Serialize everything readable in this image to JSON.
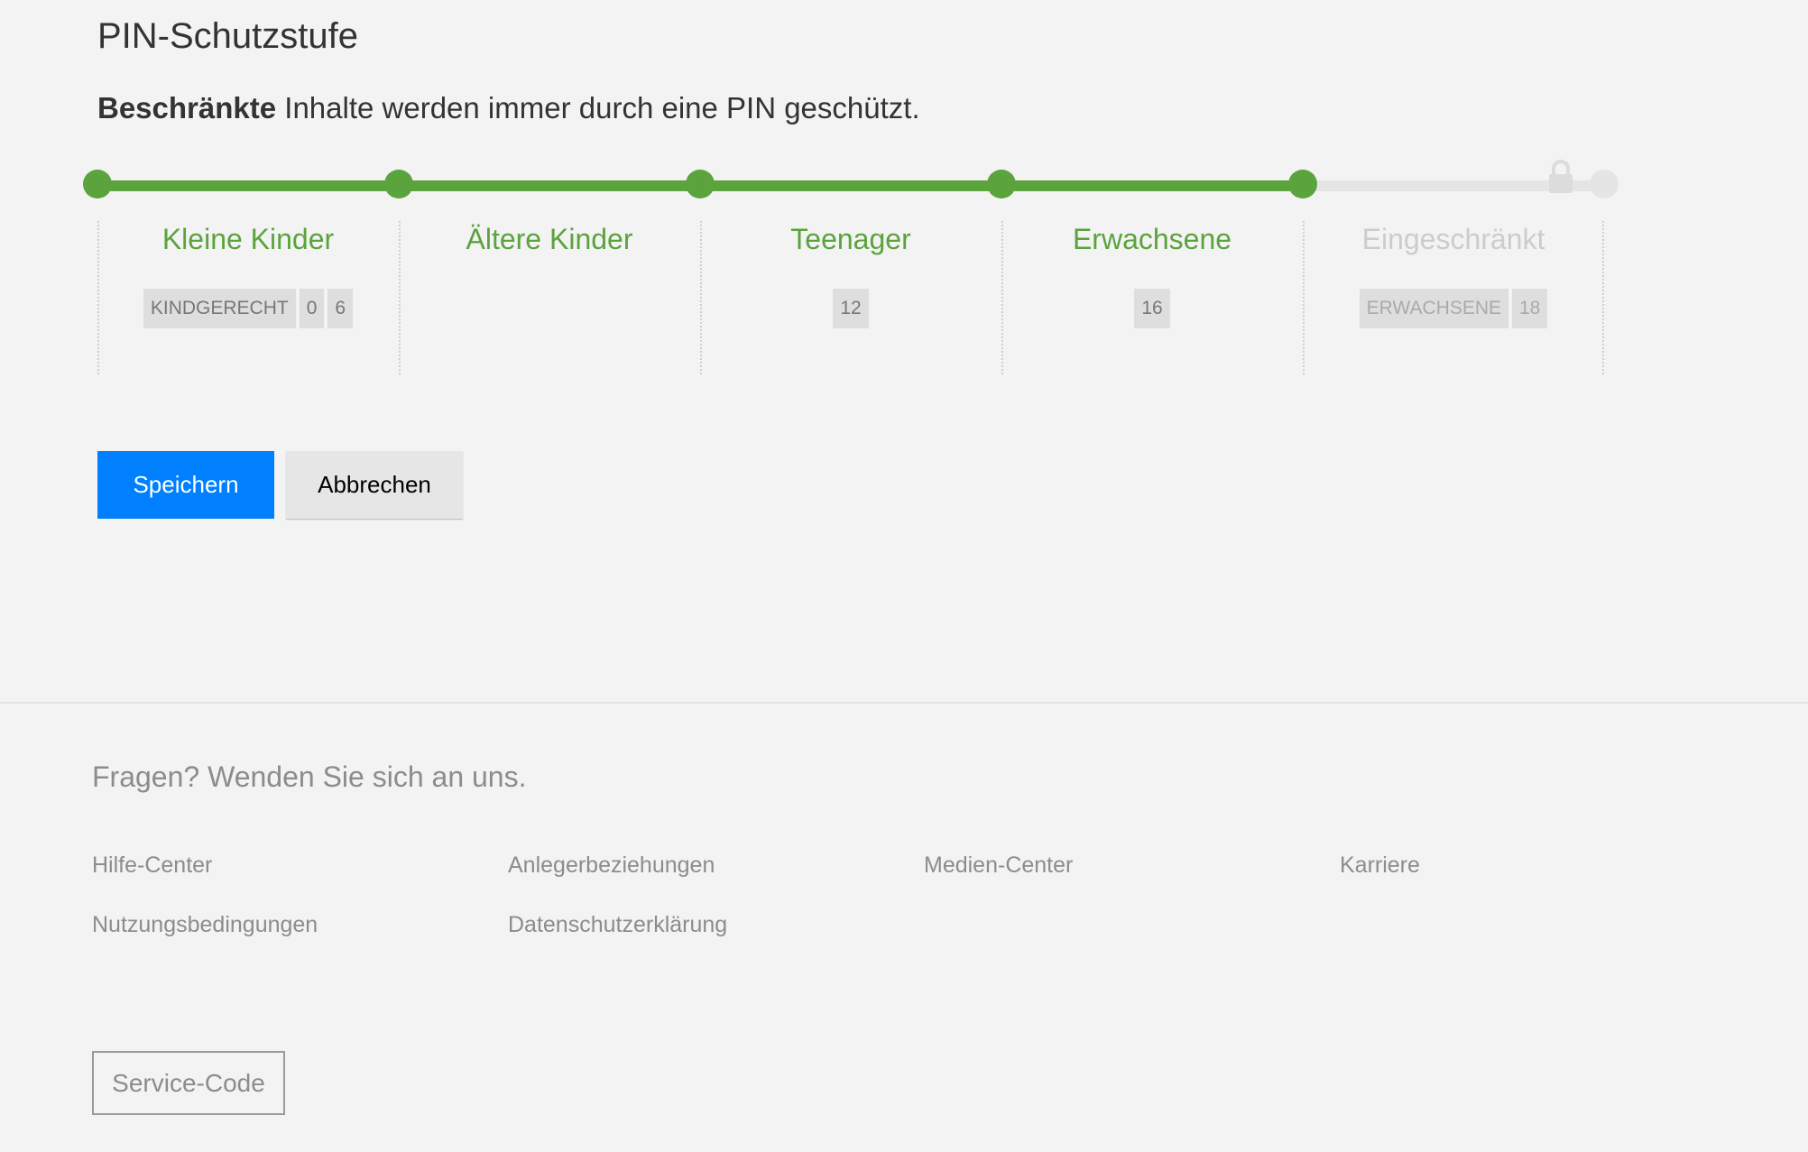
{
  "header": {
    "title": "PIN-Schutzstufe",
    "description_bold": "Beschränkte",
    "description_rest": " Inhalte werden immer durch eine PIN geschützt."
  },
  "slider": {
    "levels": [
      {
        "label": "Kleine Kinder",
        "badges": [
          "KINDGERECHT",
          "0",
          "6"
        ],
        "active": true
      },
      {
        "label": "Ältere Kinder",
        "badges": [],
        "active": true
      },
      {
        "label": "Teenager",
        "badges": [
          "12"
        ],
        "active": true
      },
      {
        "label": "Erwachsene",
        "badges": [
          "16"
        ],
        "active": true
      },
      {
        "label": "Eingeschränkt",
        "badges": [
          "ERWACHSENE",
          "18"
        ],
        "active": false
      }
    ],
    "selected_level": 4,
    "lock_icon": "lock-icon",
    "colors": {
      "active": "#5ba33d",
      "inactive": "#e5e5e5"
    }
  },
  "actions": {
    "save_label": "Speichern",
    "cancel_label": "Abbrechen",
    "save_color": "#0080ff"
  },
  "footer": {
    "heading": "Fragen? Wenden Sie sich an uns.",
    "links": [
      "Hilfe-Center",
      "Anlegerbeziehungen",
      "Medien-Center",
      "Karriere",
      "Nutzungsbedingungen",
      "Datenschutzerklärung"
    ],
    "service_code_label": "Service-Code"
  }
}
